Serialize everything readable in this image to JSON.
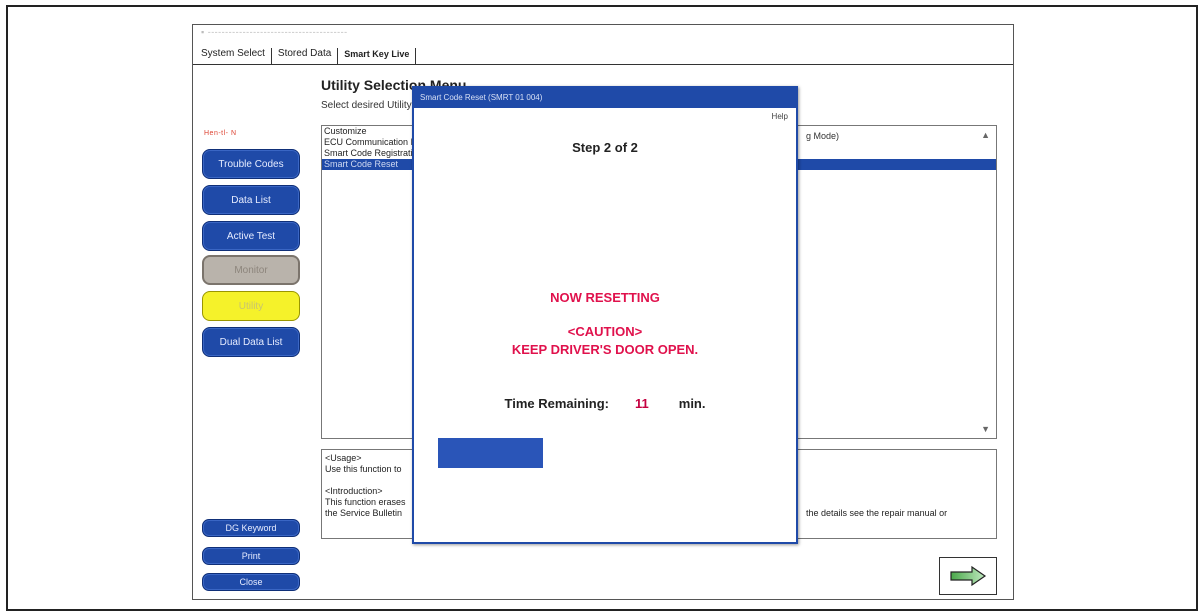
{
  "app": {
    "title_faint": "▪ ‑‑‑‑‑‑‑‑‑‑‑‑‑‑‑‑‑‑‑‑‑‑‑‑‑‑‑‑‑‑‑‑‑‑‑‑‑‑‑‑"
  },
  "tabs": [
    {
      "label": "System Select"
    },
    {
      "label": "Stored Data"
    },
    {
      "label": "Smart Key Live"
    }
  ],
  "sidebar": {
    "label": "Hen‑tl‑ N",
    "buttons": [
      {
        "label": "Trouble Codes"
      },
      {
        "label": "Data List"
      },
      {
        "label": "Active Test"
      },
      {
        "label": "Monitor"
      },
      {
        "label": "Utility"
      },
      {
        "label": "Dual Data List"
      }
    ],
    "bottom_buttons": [
      {
        "label": "DG Keyword"
      },
      {
        "label": "Print"
      },
      {
        "label": "Close"
      }
    ]
  },
  "main": {
    "heading": "Utility Selection Menu",
    "subheading": "Select desired Utility",
    "list_items": [
      "Customize",
      "ECU Communication ID Registration",
      "Smart Code Registration",
      "Smart Code Reset"
    ],
    "list_right_text": "g Mode)",
    "description": {
      "usage_header": "<Usage>",
      "usage_text": "Use this function to",
      "intro_header": "<Introduction>",
      "intro_text_1": "This function erases",
      "intro_text_2": "the Service Bulletin",
      "tail_text": "the details see the repair manual or"
    }
  },
  "dialog": {
    "title": "Smart Code Reset (SMRT 01 004)",
    "help": "Help",
    "step": "Step 2 of 2",
    "status": "NOW RESETTING",
    "caution_header": "<CAUTION>",
    "caution_text": "KEEP DRIVER'S DOOR OPEN.",
    "time_label": "Time Remaining:",
    "time_value": "11",
    "time_unit": "min.",
    "progress_fraction": 0.31
  },
  "colors": {
    "button_blue": "#1f4aa8",
    "utility_yellow": "#f5f22a",
    "alert_red": "#e0114c"
  }
}
